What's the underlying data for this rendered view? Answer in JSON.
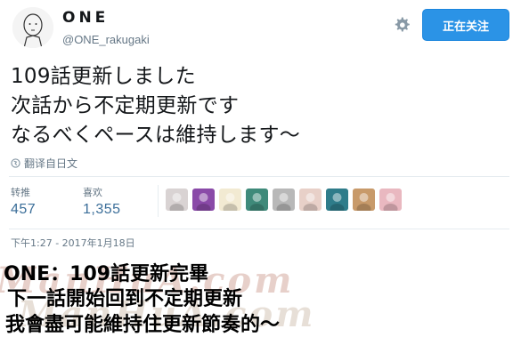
{
  "profile": {
    "display_name": "ONE",
    "handle": "@ONE_rakugaki",
    "avatar_icon": "sketch-face-avatar"
  },
  "header": {
    "settings_icon": "gear-icon",
    "follow_button_label": "正在关注",
    "follow_button_color": "#2b93e6"
  },
  "tweet": {
    "lines": [
      "109話更新しました",
      "次話から不定期更新です",
      "なるべくペースは維持します〜"
    ],
    "translate_label": "翻译自日文"
  },
  "stats": {
    "retweets_label": "转推",
    "retweets_count": "457",
    "likes_label": "喜欢",
    "likes_count": "1,355"
  },
  "likers": [
    {
      "name": "liker-avatar-1",
      "color": "#d9d3d3"
    },
    {
      "name": "liker-avatar-2",
      "color": "#8a4aa8"
    },
    {
      "name": "liker-avatar-3",
      "color": "#f2ead2"
    },
    {
      "name": "liker-avatar-4",
      "color": "#3f8a7a"
    },
    {
      "name": "liker-avatar-5",
      "color": "#b8b8b8"
    },
    {
      "name": "liker-avatar-6",
      "color": "#e8d0c8"
    },
    {
      "name": "liker-avatar-7",
      "color": "#2f7c8a"
    },
    {
      "name": "liker-avatar-8",
      "color": "#c89a6a"
    },
    {
      "name": "liker-avatar-9",
      "color": "#e9b8c0"
    }
  ],
  "timestamp": "下午1:27 - 2017年1月18日",
  "watermark": {
    "line_1": "ManHuA.com",
    "line_2": "ManHuA.com"
  },
  "subtitles": [
    "ONE：109話更新完畢",
    "下一話開始回到不定期更新",
    "我會盡可能維持住更新節奏的〜"
  ]
}
